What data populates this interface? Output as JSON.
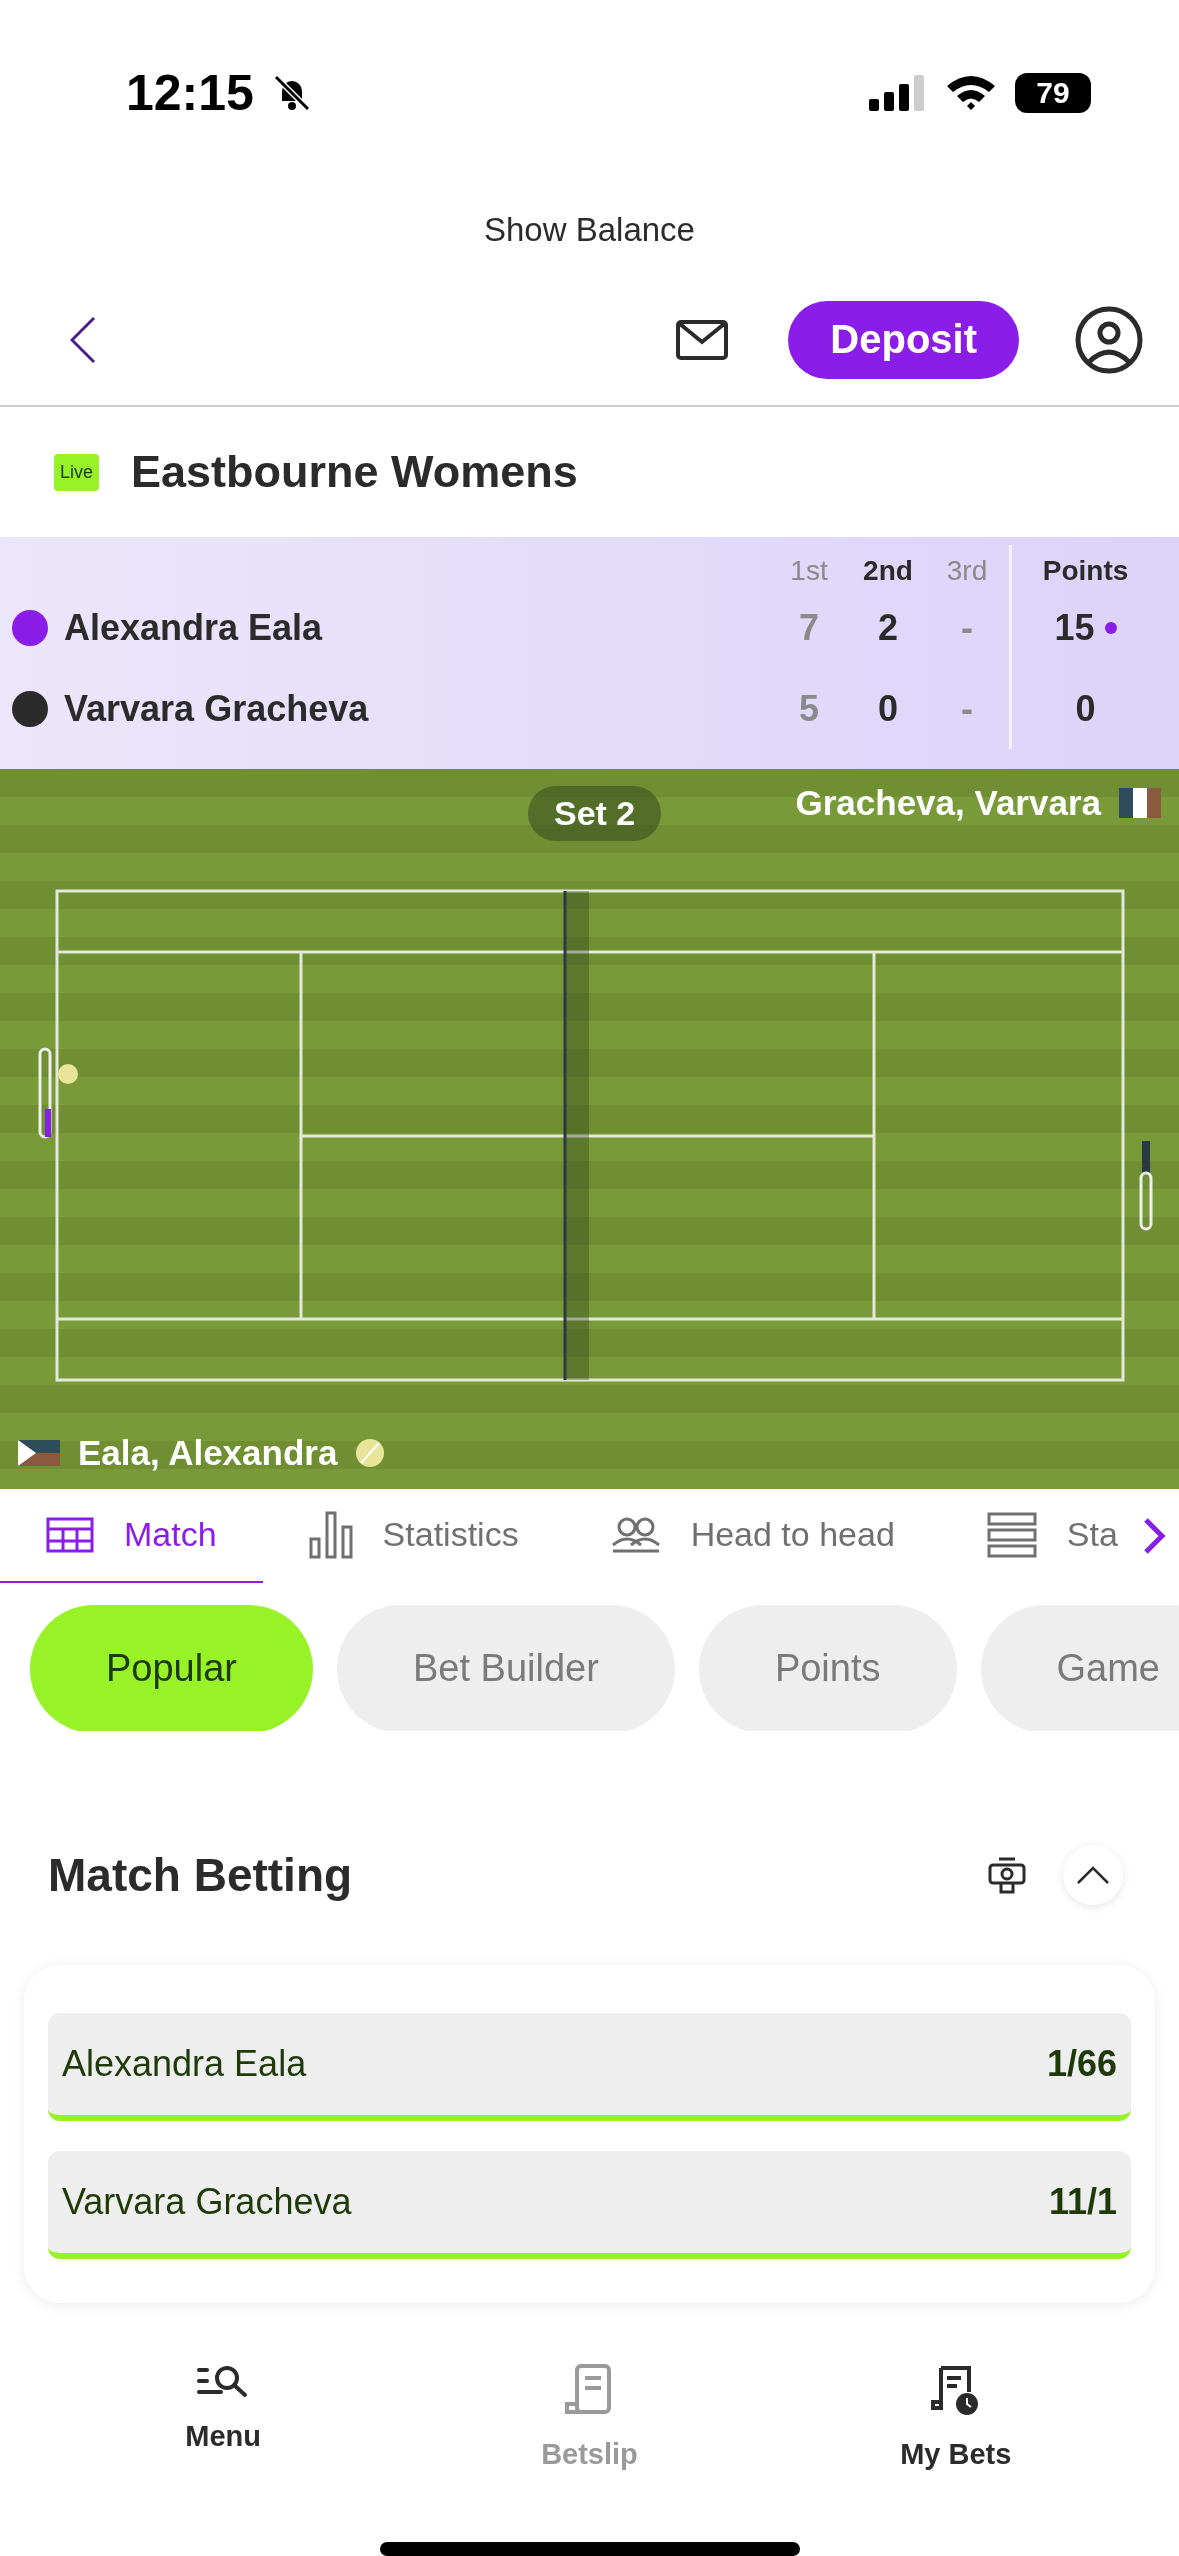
{
  "status_bar": {
    "time": "12:15",
    "battery": "79"
  },
  "header": {
    "balance_link": "Show Balance",
    "deposit_button": "Deposit"
  },
  "event": {
    "live_badge": "Live",
    "title": "Eastbourne Womens"
  },
  "scoreboard": {
    "columns": [
      {
        "label": "1st",
        "current": false
      },
      {
        "label": "2nd",
        "current": true
      },
      {
        "label": "3rd",
        "current": false
      }
    ],
    "points_label": "Points",
    "players": [
      {
        "name": "Alexandra Eala",
        "color": "#8a1ee8",
        "sets": [
          "7",
          "2",
          "-"
        ],
        "points": "15",
        "serving": true
      },
      {
        "name": "Varvara Gracheva",
        "color": "#2b2b2b",
        "sets": [
          "5",
          "0",
          "-"
        ],
        "points": "0",
        "serving": false
      }
    ]
  },
  "court": {
    "set_label": "Set 2",
    "top_player": {
      "name": "Gracheva, Varvara",
      "serving": false
    },
    "bottom_player": {
      "name": "Eala, Alexandra",
      "serving": true
    }
  },
  "tabs": [
    {
      "label": "Match",
      "selected": true
    },
    {
      "label": "Statistics",
      "selected": false
    },
    {
      "label": "Head to head",
      "selected": false
    },
    {
      "label": "Sta",
      "selected": false
    }
  ],
  "chips": [
    {
      "label": "Popular",
      "selected": true
    },
    {
      "label": "Bet Builder",
      "selected": false
    },
    {
      "label": "Points",
      "selected": false
    },
    {
      "label": "Game",
      "selected": false
    }
  ],
  "market": {
    "title": "Match Betting",
    "expanded": true,
    "selections": [
      {
        "name": "Alexandra Eala",
        "odds": "1/66"
      },
      {
        "name": "Varvara Gracheva",
        "odds": "11/1"
      }
    ]
  },
  "bottom_nav": [
    {
      "label": "Menu",
      "disabled": false
    },
    {
      "label": "Betslip",
      "disabled": true
    },
    {
      "label": "My Bets",
      "disabled": false
    }
  ]
}
